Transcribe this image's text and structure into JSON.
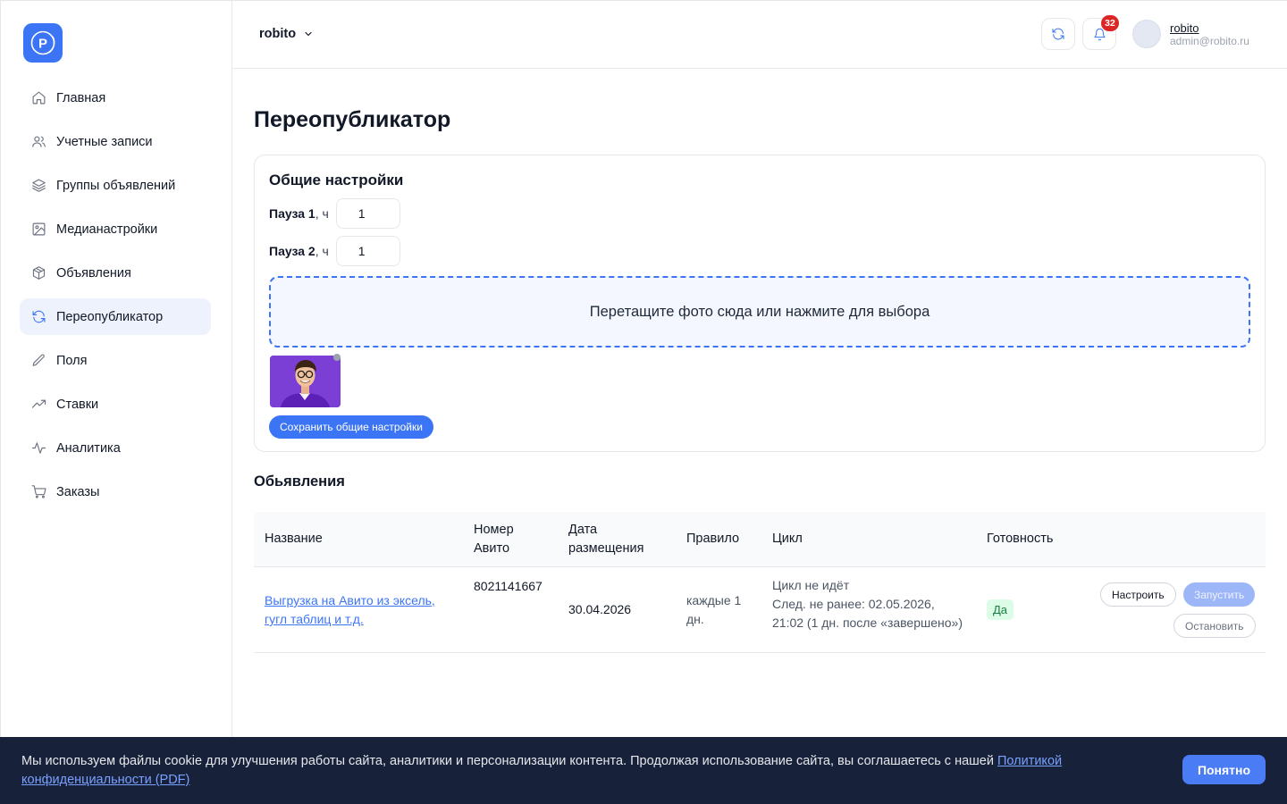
{
  "app": {
    "org_name": "robito",
    "brand_color": "#3b74f5",
    "logo_letter": "P"
  },
  "sidebar": {
    "items": [
      {
        "label": "Главная",
        "icon": "home-icon",
        "active": false
      },
      {
        "label": "Учетные записи",
        "icon": "users-icon",
        "active": false
      },
      {
        "label": "Группы объявлений",
        "icon": "layers-icon",
        "active": false
      },
      {
        "label": "Медианастройки",
        "icon": "image-icon",
        "active": false
      },
      {
        "label": "Объявления",
        "icon": "box-icon",
        "active": false
      },
      {
        "label": "Переопубликатор",
        "icon": "refresh-icon",
        "active": true
      },
      {
        "label": "Поля",
        "icon": "pencil-icon",
        "active": false
      },
      {
        "label": "Ставки",
        "icon": "trending-up-icon",
        "active": false
      },
      {
        "label": "Аналитика",
        "icon": "activity-icon",
        "active": false
      },
      {
        "label": "Заказы",
        "icon": "cart-icon",
        "active": false
      }
    ]
  },
  "header": {
    "notifications_count": "32",
    "user_name": "robito",
    "user_email": "admin@robito.ru"
  },
  "page": {
    "title": "Переопубликатор",
    "settings": {
      "title": "Общие настройки",
      "pause1_label": "Пауза 1",
      "pause1_unit": ", ч",
      "pause1_value": "1",
      "pause2_label": "Пауза 2",
      "pause2_unit": ", ч",
      "pause2_value": "1",
      "dropzone_text": "Перетащите фото сюда или нажмите для выбора",
      "save_button": "Сохранить общие настройки"
    },
    "ads_section_title": "Обьявления",
    "table": {
      "headers": {
        "name": "Название",
        "avito_line1": "Номер",
        "avito_line2": "Авито",
        "date_line1": "Дата",
        "date_line2": "размещения",
        "rule": "Правило",
        "cycle": "Цикл",
        "ready": "Готовность"
      },
      "rows": [
        {
          "name_line1": "Выгрузка на Авито из эксель,",
          "name_line2": "гугл таблиц и т.д.",
          "avito_number": "8021141667",
          "date": "30.04.2026",
          "rule_line1": "каждые 1",
          "rule_line2": "дн.",
          "cycle_line1": "Цикл не идёт",
          "cycle_line2": "След. не ранее: 02.05.2026,",
          "cycle_line3": "21:02 (1 дн. после «завершено»)",
          "ready": "Да",
          "btn_configure": "Настроить",
          "btn_start": "Запустить",
          "btn_stop": "Остановить"
        }
      ]
    }
  },
  "cookie": {
    "text": "Мы используем файлы cookie для улучшения работы сайта, аналитики и персонализации контента. Продолжая использование сайта, вы соглашаетесь с нашей ",
    "link_text": "Политикой конфиденциальности (PDF)",
    "button": "Понятно"
  }
}
